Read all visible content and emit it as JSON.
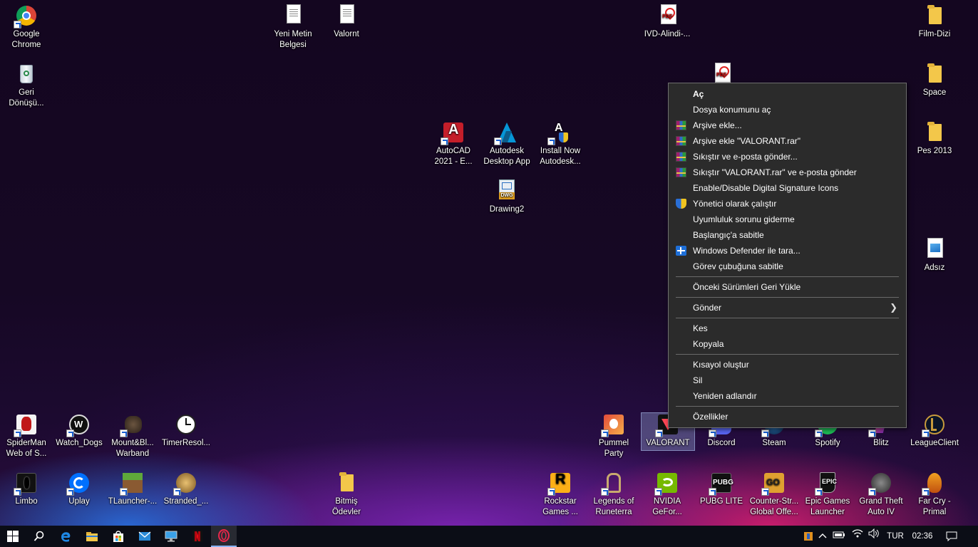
{
  "desktop_icons": {
    "chrome": "Google Chrome",
    "recycle": "Geri Dönüşü...",
    "yeni_metin": "Yeni Metin Belgesi",
    "valornt": "Valornt",
    "ivd": "IVD-Alindi-...",
    "film_dizi": "Film-Dizi",
    "space": "Space",
    "pes2013": "Pes 2013",
    "adsiz": "Adsız",
    "autocad": "AutoCAD 2021 - E...",
    "autodesk_app": "Autodesk Desktop App",
    "install_now": "Install Now Autodesk...",
    "drawing2": "Drawing2",
    "spiderman": "SpiderMan Web of S...",
    "watch_dogs": "Watch_Dogs",
    "mount_blade": "Mount&Bl... Warband",
    "timer": "TimerResol...",
    "pummel": "Pummel Party",
    "valorant": "VALORANT",
    "discord": "Discord",
    "steam": "Steam",
    "spotify": "Spotify",
    "blitz": "Blitz",
    "league": "LeagueClient",
    "limbo": "Limbo",
    "uplay": "Uplay",
    "tlauncher": "TLauncher-...",
    "stranded": "Stranded_...",
    "bitmis": "Bitmiş Ödevler",
    "rockstar": "Rockstar Games ...",
    "runeterra": "Legends of Runeterra",
    "nvidia": "NVIDIA GeFor...",
    "pubg": "PUBG LITE",
    "csgo": "Counter-Str... Global Offe...",
    "epic": "Epic Games Launcher",
    "gta": "Grand Theft Auto IV",
    "farcry": "Far Cry - Primal"
  },
  "context_menu": {
    "open": "Aç",
    "open_location": "Dosya konumunu aç",
    "add_archive": "Arşive ekle...",
    "add_rar": "Arşive ekle \"VALORANT.rar\"",
    "compress_email": "Sıkıştır ve e-posta gönder...",
    "compress_rar_email": "Sıkıştır \"VALORANT.rar\" ve e-posta gönder",
    "digital_sig": "Enable/Disable Digital Signature Icons",
    "run_admin": "Yönetici olarak çalıştır",
    "troubleshoot": "Uyumluluk sorunu giderme",
    "pin_start": "Başlangıç'a sabitle",
    "defender": "Windows Defender ile tara...",
    "pin_taskbar": "Görev çubuğuna sabitle",
    "restore_versions": "Önceki Sürümleri Geri Yükle",
    "send_to": "Gönder",
    "cut": "Kes",
    "copy": "Kopyala",
    "create_shortcut": "Kısayol oluştur",
    "delete": "Sil",
    "rename": "Yeniden adlandır",
    "properties": "Özellikler"
  },
  "taskbar": {
    "language": "TUR",
    "time": "02:36"
  },
  "colors": {
    "menu_bg": "#2b2b2b",
    "taskbar_bg": "#0b0d16",
    "selection": "#a0b4e6"
  }
}
